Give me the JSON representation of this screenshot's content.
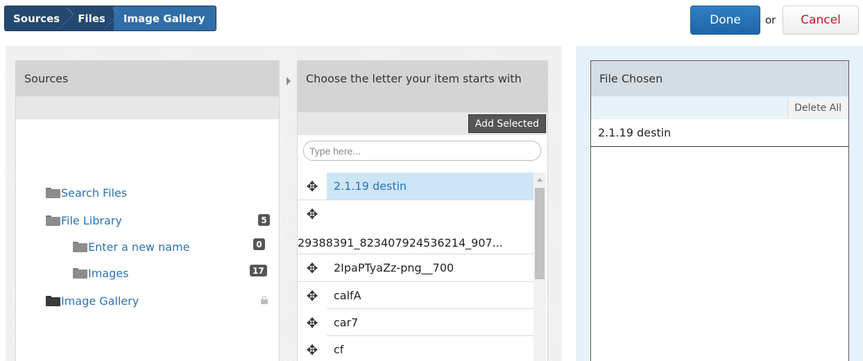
{
  "breadcrumb": {
    "items": [
      "Sources",
      "Files",
      "Image Gallery"
    ]
  },
  "actions": {
    "done_label": "Done",
    "or_label": "or",
    "cancel_label": "Cancel"
  },
  "sources": {
    "title": "Sources",
    "tree": [
      {
        "label": "Search Files",
        "icon": "folder-icon"
      },
      {
        "label": "File Library",
        "icon": "folder-icon",
        "count": "5"
      },
      {
        "label": "Enter a new name",
        "icon": "folder-icon",
        "count": "0"
      },
      {
        "label": "Images",
        "icon": "folder-icon",
        "count": "17"
      },
      {
        "label": "Image Gallery",
        "icon": "folder-open-icon",
        "locked": true
      }
    ]
  },
  "list": {
    "title": "Choose the letter your item starts with",
    "add_selected_label": "Add Selected",
    "search_placeholder": "Type here...",
    "items": [
      "2.1.19 destin",
      "29388391_823407924536214_907...",
      "2IpaPTyaZz-png__700",
      "calfA",
      "car7",
      "cf"
    ],
    "handle_glyph": "✥"
  },
  "chosen": {
    "title": "File Chosen",
    "delete_all_label": "Delete All",
    "items": [
      "2.1.19 destin"
    ]
  },
  "colors": {
    "brand_dark": "#24486f",
    "brand_active": "#2f6ea6",
    "primary_button": "#1f65a8",
    "cancel_text": "#c8102e",
    "link": "#2a72b5",
    "selected_row": "#cce6f7"
  }
}
